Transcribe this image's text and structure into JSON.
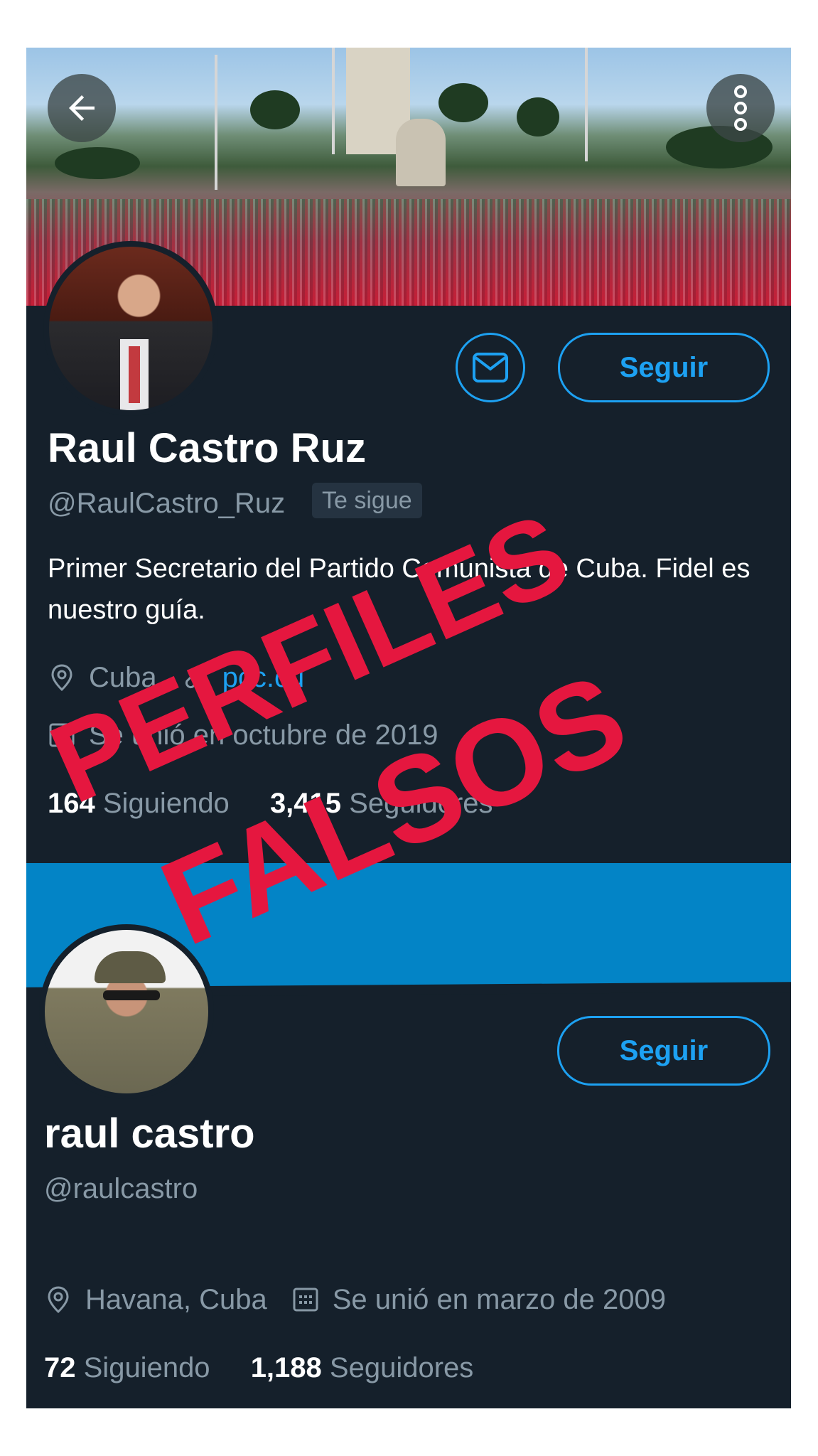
{
  "profile1": {
    "name": "Raul Castro Ruz",
    "handle": "@RaulCastro_Ruz",
    "follows_you_badge": "Te sigue",
    "bio": "Primer Secretario del Partido Comunista de Cuba. Fidel es nuestro guía.",
    "location": "Cuba",
    "website": "pcc.cu",
    "joined": "Se unió en octubre de 2019",
    "following_count": "164",
    "following_label": "Siguiendo",
    "followers_count": "3,415",
    "followers_label": "Seguidores",
    "follow_button": "Seguir"
  },
  "profile2": {
    "name": "raul castro",
    "handle": "@raulcastro",
    "location": "Havana, Cuba",
    "joined": "Se unió en marzo de 2009",
    "following_count": "72",
    "following_label": "Siguiendo",
    "followers_count": "1,188",
    "followers_label": "Seguidores",
    "follow_button": "Seguir"
  },
  "overlay": {
    "line1": "PERFILES",
    "line2": "FALSOS"
  },
  "colors": {
    "background": "#15202b",
    "accent": "#1da1f2",
    "secondary_text": "#8899a6",
    "overlay_red": "#e5173f",
    "banner2": "#0384c6"
  },
  "icons": [
    "back-arrow-icon",
    "more-vertical-icon",
    "mail-icon",
    "location-pin-icon",
    "link-icon",
    "calendar-icon"
  ]
}
